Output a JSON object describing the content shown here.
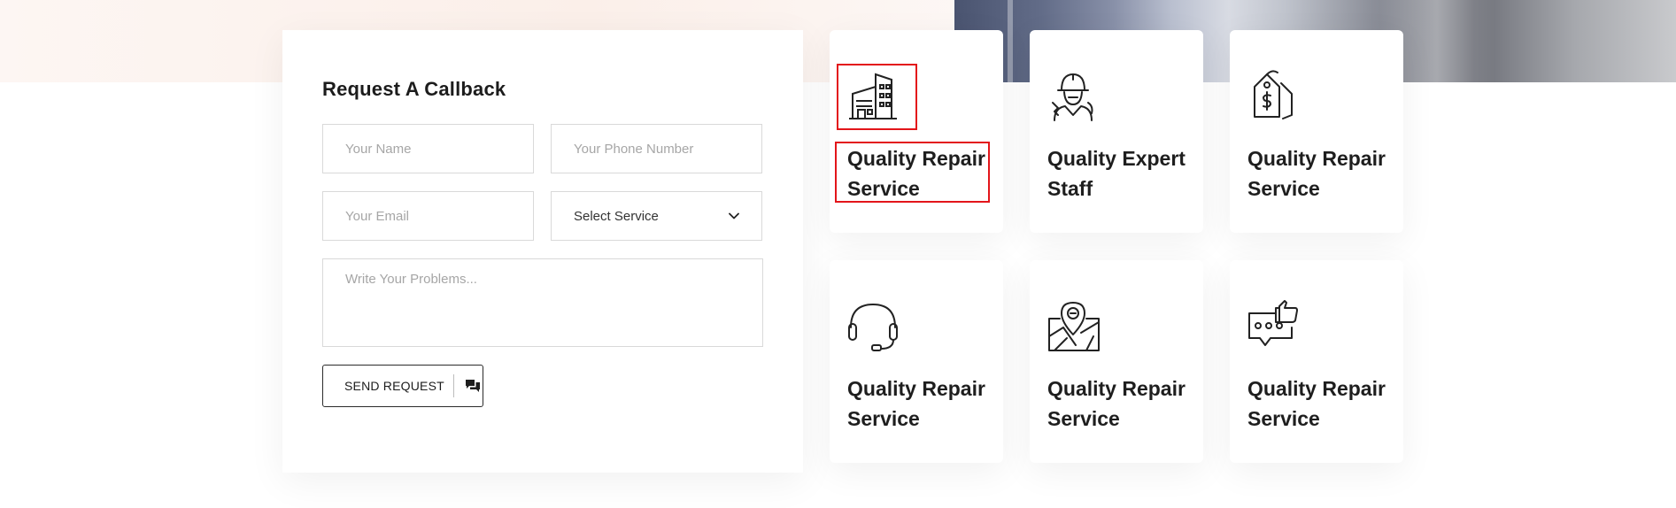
{
  "form": {
    "title": "Request A Callback",
    "name_placeholder": "Your Name",
    "phone_placeholder": "Your Phone Number",
    "email_placeholder": "Your Email",
    "service_selected": "Select Service",
    "problem_placeholder": "Write Your Problems...",
    "send_label": "SEND REQUEST"
  },
  "features": [
    {
      "title": "Quality Repair Service",
      "icon": "building-icon"
    },
    {
      "title": "Quality Expert Staff",
      "icon": "worker-icon"
    },
    {
      "title": "Quality Repair Service",
      "icon": "price-tag-icon"
    },
    {
      "title": "Quality Repair Service",
      "icon": "headset-icon"
    },
    {
      "title": "Quality Repair Service",
      "icon": "map-pin-icon"
    },
    {
      "title": "Quality Repair Service",
      "icon": "chat-thumbs-up-icon"
    }
  ],
  "colors": {
    "highlight": "#e3151a",
    "text": "#1e1e1e"
  }
}
